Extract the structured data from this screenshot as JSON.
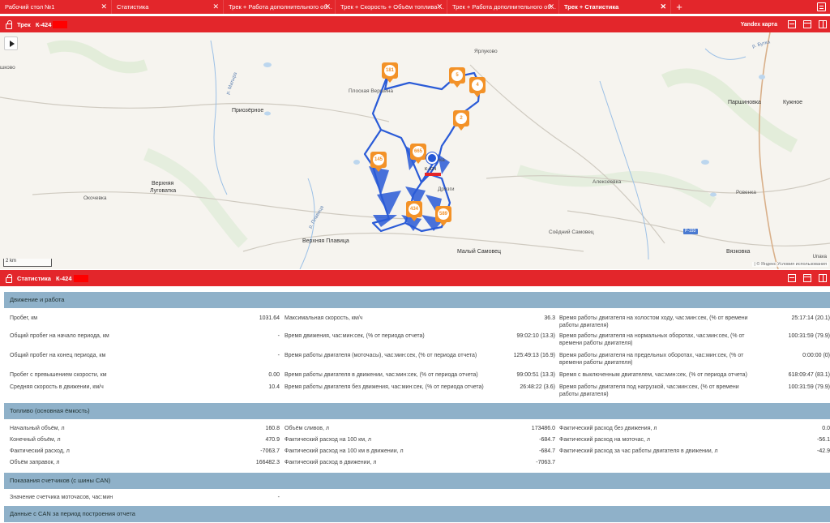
{
  "tabs": [
    {
      "label": "Рабочий стол №1",
      "active": false
    },
    {
      "label": "Статистика",
      "active": false
    },
    {
      "label": "Трек + Работа дополнительного об...",
      "active": false
    },
    {
      "label": "Трек + Скорость + Объём топлива ...",
      "active": false
    },
    {
      "label": "Трек + Работа дополнительного об...",
      "active": false
    },
    {
      "label": "Трек + Статистика",
      "active": true
    }
  ],
  "track_panel": {
    "title": "Трек",
    "vehicle": "К-424",
    "map_provider": "Yandex карта"
  },
  "map": {
    "towns": [
      {
        "name": "шково",
        "cls": "small"
      },
      {
        "name": "Приозёрное",
        "cls": ""
      },
      {
        "name": "Плоская Вершина",
        "cls": "small"
      },
      {
        "name": "Ярлуково",
        "cls": "small"
      },
      {
        "name": "Паршиновка",
        "cls": ""
      },
      {
        "name": "Кужное",
        "cls": ""
      },
      {
        "name": "Окочевка",
        "cls": "small"
      },
      {
        "name": "Верхняя",
        "cls": ""
      },
      {
        "name": "Луговатка",
        "cls": ""
      },
      {
        "name": "Алексеевка",
        "cls": "small"
      },
      {
        "name": "Ровенка",
        "cls": "small"
      },
      {
        "name": "Соёдний Самовец",
        "cls": "small"
      },
      {
        "name": "Верхняя Плавица",
        "cls": ""
      },
      {
        "name": "Малый Самовец",
        "cls": ""
      },
      {
        "name": "Вязковка",
        "cls": ""
      },
      {
        "name": "Дрязги",
        "cls": "small"
      },
      {
        "name": "...ровка",
        "cls": "small"
      }
    ],
    "rivers": [
      "р. Матыра",
      "р. Плавица",
      "р. Бутка",
      "Р-193"
    ],
    "markers": [
      "181",
      "5",
      "4",
      "2",
      "145",
      "665",
      "434",
      "589"
    ],
    "vehicle_label": "К-424",
    "scale_label": "2 km",
    "copyright": "| © Яндекс Условия использования",
    "unavailable": "Unava"
  },
  "stats_panel": {
    "title": "Статистика",
    "vehicle": "К-424"
  },
  "sections": {
    "movement": {
      "title": "Движение и работа",
      "col1": [
        {
          "label": "Пробег, км",
          "value": "1031.64"
        },
        {
          "label": "Общий пробег на начало периода, км",
          "value": "-"
        },
        {
          "label": "Общий пробег на конец периода, км",
          "value": "-"
        },
        {
          "label": "Пробег с превышением скорости, км",
          "value": "0.00"
        },
        {
          "label": "Средняя скорость в движении, км/ч",
          "value": "10.4"
        }
      ],
      "col2": [
        {
          "label": "Максимальная скорость, км/ч",
          "value": "36.3"
        },
        {
          "label": "Время движения, час:мин:сек, (% от периода отчета)",
          "value": "99:02:10 (13.3)"
        },
        {
          "label": "Время работы двигателя (моточасы), час:мин:сек, (% от периода отчета)",
          "value": "125:49:13 (16.9)"
        },
        {
          "label": "Время работы двигателя в движении, час:мин:сек, (% от периода отчета)",
          "value": "99:00:51 (13.3)"
        },
        {
          "label": "Время работы двигателя без движения, час:мин:сек, (% от периода отчета)",
          "value": "26:48:22 (3.6)"
        }
      ],
      "col3": [
        {
          "label": "Время работы двигателя на холостом ходу, час:мин:сек, (% от времени работы двигателя)",
          "value": "25:17:14 (20.1)"
        },
        {
          "label": "Время работы двигателя на нормальных оборотах, час:мин:сек, (% от времени работы двигателя)",
          "value": "100:31:59 (79.9)"
        },
        {
          "label": "Время работы двигателя на предельных оборотах, час:мин:сек, (% от времени работы двигателя)",
          "value": "0:00:00 (0)"
        },
        {
          "label": "Время с выключенным двигателем, час:мин:сек, (% от периода отчета)",
          "value": "618:09:47 (83.1)"
        },
        {
          "label": "Время работы двигателя под нагрузкой, час:мин:сек, (% от времени работы двигателя)",
          "value": "100:31:59 (79.9)"
        }
      ]
    },
    "fuel": {
      "title": "Топливо (основная ёмкость)",
      "col1": [
        {
          "label": "Начальный объём, л",
          "value": "160.8"
        },
        {
          "label": "Конечный объём, л",
          "value": "470.9"
        },
        {
          "label": "Фактический расход, л",
          "value": "-7063.7"
        },
        {
          "label": "Объём заправок, л",
          "value": "166482.3"
        }
      ],
      "col2": [
        {
          "label": "Объём сливов, л",
          "value": "173486.0"
        },
        {
          "label": "Фактический расход на 100 км, л",
          "value": "-684.7"
        },
        {
          "label": "Фактический расход на 100 км в движении, л",
          "value": "-684.7"
        },
        {
          "label": "Фактический расход в движении, л",
          "value": "-7063.7"
        }
      ],
      "col3": [
        {
          "label": "Фактический расход без движения, л",
          "value": "0.0"
        },
        {
          "label": "Фактический расход на моточас, л",
          "value": "-56.1"
        },
        {
          "label": "Фактический расход за час работы двигателя в движении, л",
          "value": "-42.9"
        }
      ]
    },
    "counters": {
      "title": "Показания счетчиков (с шины CAN)",
      "rows": [
        {
          "label": "Значение счетчика моточасов, час:мин",
          "value": "-"
        }
      ]
    },
    "can": {
      "title": "Данные с CAN за период построения отчета"
    }
  }
}
